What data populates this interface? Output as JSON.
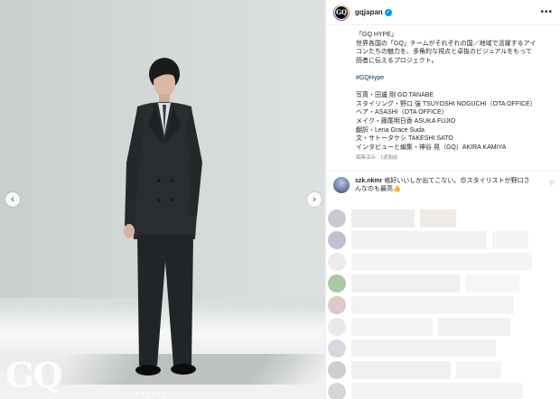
{
  "post": {
    "brand_watermark": "GQ",
    "carousel": {
      "total_slides": 6,
      "current_slide": 1
    }
  },
  "header": {
    "avatar_text": "GQ",
    "username": "gqjapan",
    "verified": true
  },
  "caption": {
    "lines": [
      "「GQ HYPE」",
      "世界各国の「GQ」チームがそれぞれの国／地域で活躍するアイ",
      "コンたちの魅力を、多角的な視点と卓抜のビジュアルをもって",
      "読者に伝えるプロジェクト。"
    ],
    "hashtag": "#GQHype",
    "credits": [
      "写真・田邊 剛 GO TANABE",
      "スタイリング・野口 強 TSUYOSHI NOGUCHI（OTA OFFICE）",
      "ヘア・ASASHI（OTA OFFICE）",
      "メイク・藤尾明日香 ASUKA FUJIO",
      "翻訳・Lena Grace Suda",
      "文・サトータケシ TAKESHI SATO",
      "インタビューと編集・神谷 晃（GQ）AKIRA KAMIYA"
    ],
    "meta": "編集済み · 1週間前"
  },
  "comment": {
    "username": "szk.nkmr",
    "text_line1": "格好いいしか出てこない。😍スタイリストが野口さ",
    "text_line2": "んなのも最高👍"
  },
  "colors": {
    "accent": "#0095f6",
    "hashtag": "#00376b",
    "muted": "#8e8e8e"
  }
}
